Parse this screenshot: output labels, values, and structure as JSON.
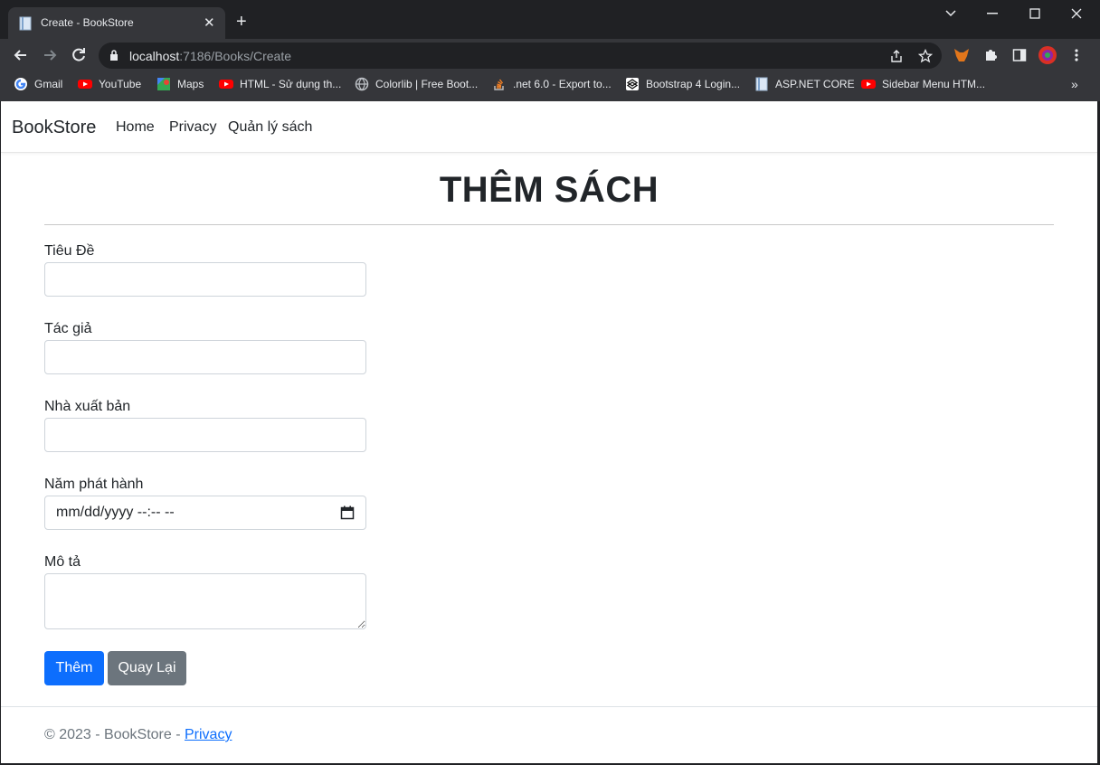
{
  "browser": {
    "tab_title": "Create - BookStore",
    "url_host": "localhost",
    "url_path": ":7186/Books/Create",
    "bookmarks": [
      {
        "label": "Gmail",
        "icon": "google-icon"
      },
      {
        "label": "YouTube",
        "icon": "youtube-icon"
      },
      {
        "label": "Maps",
        "icon": "maps-icon"
      },
      {
        "label": "HTML - Sử dụng th...",
        "icon": "youtube-icon"
      },
      {
        "label": "Colorlib | Free Boot...",
        "icon": "globe-icon"
      },
      {
        "label": ".net 6.0 - Export to...",
        "icon": "stackoverflow-icon"
      },
      {
        "label": "Bootstrap 4 Login...",
        "icon": "codepen-icon"
      },
      {
        "label": "ASP.NET CORE",
        "icon": "document-icon"
      },
      {
        "label": "Sidebar Menu HTM...",
        "icon": "youtube-icon"
      }
    ],
    "bookmarks_overflow": "»"
  },
  "navbar": {
    "brand": "BookStore",
    "links": [
      "Home",
      "Privacy",
      "Quản lý sách"
    ]
  },
  "form": {
    "title": "THÊM SÁCH",
    "fields": {
      "title_label": "Tiêu Đề",
      "author_label": "Tác giả",
      "publisher_label": "Nhà xuất bản",
      "year_label": "Năm phát hành",
      "year_placeholder": "mm/dd/yyyy --:-- --",
      "description_label": "Mô tả"
    },
    "submit_label": "Thêm",
    "back_label": "Quay Lại"
  },
  "footer": {
    "text": "© 2023 - BookStore - ",
    "link": "Privacy"
  },
  "colors": {
    "primary": "#0d6efd",
    "secondary": "#6c757d",
    "chrome_dark": "#202124",
    "chrome_toolbar": "#35363a"
  }
}
